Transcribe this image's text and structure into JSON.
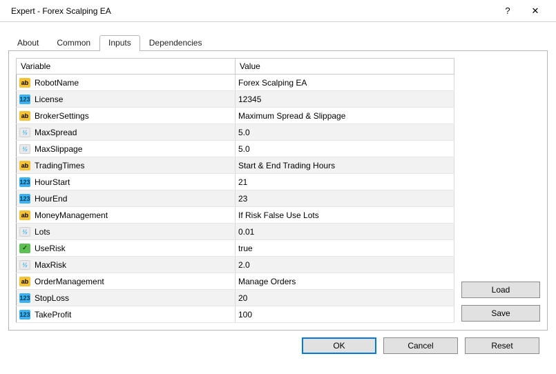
{
  "window": {
    "title": "Expert - Forex Scalping EA",
    "help_icon": "?",
    "close_icon": "✕"
  },
  "tabs": {
    "about": "About",
    "common": "Common",
    "inputs": "Inputs",
    "dependencies": "Dependencies"
  },
  "grid": {
    "col_variable": "Variable",
    "col_value": "Value",
    "rows": [
      {
        "type": "ab",
        "name": "RobotName",
        "value": "Forex Scalping EA"
      },
      {
        "type": "123",
        "name": "License",
        "value": "12345"
      },
      {
        "type": "ab",
        "name": "BrokerSettings",
        "value": "Maximum Spread & Slippage"
      },
      {
        "type": "v2",
        "name": "MaxSpread",
        "value": "5.0"
      },
      {
        "type": "v2",
        "name": "MaxSlippage",
        "value": "5.0"
      },
      {
        "type": "ab",
        "name": "TradingTimes",
        "value": "Start & End Trading Hours"
      },
      {
        "type": "123",
        "name": "HourStart",
        "value": "21"
      },
      {
        "type": "123",
        "name": "HourEnd",
        "value": "23"
      },
      {
        "type": "ab",
        "name": "MoneyManagement",
        "value": "If Risk False Use Lots"
      },
      {
        "type": "v2",
        "name": "Lots",
        "value": "0.01"
      },
      {
        "type": "bool",
        "name": "UseRisk",
        "value": "true"
      },
      {
        "type": "v2",
        "name": "MaxRisk",
        "value": "2.0"
      },
      {
        "type": "ab",
        "name": "OrderManagement",
        "value": "Manage Orders"
      },
      {
        "type": "123",
        "name": "StopLoss",
        "value": "20"
      },
      {
        "type": "123",
        "name": "TakeProfit",
        "value": "100"
      }
    ]
  },
  "buttons": {
    "load": "Load",
    "save": "Save",
    "ok": "OK",
    "cancel": "Cancel",
    "reset": "Reset"
  },
  "type_glyphs": {
    "ab": "ab",
    "123": "123",
    "v2": "½",
    "bool": "✓"
  }
}
